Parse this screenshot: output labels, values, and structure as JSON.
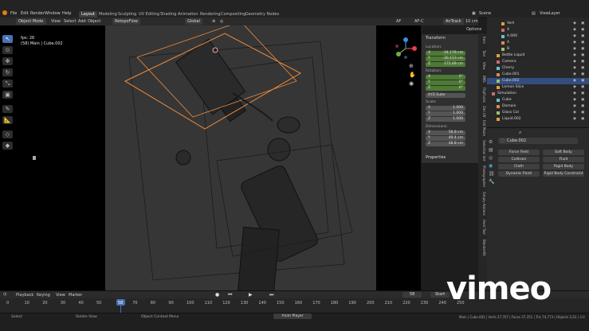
{
  "menu": [
    "File",
    "Edit",
    "Render",
    "Window",
    "Help"
  ],
  "workspaces": [
    "Layout",
    "Modeling",
    "Sculpting",
    "UV Editing",
    "Shading",
    "Animation",
    "Rendering",
    "Compositing",
    "Geometry Nodes"
  ],
  "scene_label": "Scene",
  "viewlayer_label": "ViewLayer",
  "header": {
    "mode": "Object Mode",
    "view": "View",
    "select": "Select",
    "add": "Add",
    "object": "Object",
    "addon": "RetopoFlow",
    "orientation": "Global",
    "options": "Options",
    "af": "AF",
    "ak": "AnTrack",
    "zoom": "10 cm"
  },
  "viewport_overlay": {
    "fps": "fps: 26",
    "object_info": "(58) Main | Cube.002"
  },
  "npanel": {
    "section": "Transform",
    "location_label": "Location:",
    "location": [
      {
        "k": "X",
        "v": "-34.178 cm"
      },
      {
        "k": "Y",
        "v": "-30.113 cm"
      },
      {
        "k": "Z",
        "v": "172.69 cm"
      }
    ],
    "rotation_label": "Rotation:",
    "rotation": [
      {
        "k": "X",
        "v": "0°"
      },
      {
        "k": "Y",
        "v": "0°"
      },
      {
        "k": "Z",
        "v": "0°"
      }
    ],
    "rotation_mode": "XYZ Euler",
    "scale_label": "Scale:",
    "scale": [
      {
        "k": "X",
        "v": "1.000"
      },
      {
        "k": "Y",
        "v": "1.000"
      },
      {
        "k": "Z",
        "v": "1.000"
      }
    ],
    "dimensions_label": "Dimensions:",
    "dimensions": [
      {
        "k": "X",
        "v": "58.8 cm"
      },
      {
        "k": "Y",
        "v": "49.4 cm"
      },
      {
        "k": "Z",
        "v": "48.8 cm"
      }
    ],
    "properties": "Properties"
  },
  "side_tabs": [
    "Item",
    "Tool",
    "View",
    "BMS",
    "FlipFluids",
    "Zen UV",
    "Edit Mode",
    "Selection Set",
    "Photographer",
    "Simply Addons",
    "Hard Tool",
    "BlenderKit"
  ],
  "outliner": [
    {
      "name": "Vert",
      "indent": 2,
      "sel": false
    },
    {
      "name": "X",
      "indent": 2,
      "sel": false
    },
    {
      "name": "A.000",
      "indent": 2,
      "sel": false
    },
    {
      "name": "A",
      "indent": 2,
      "sel": false
    },
    {
      "name": "B",
      "indent": 2,
      "sel": false
    },
    {
      "name": "Bottle Liquid",
      "indent": 1,
      "sel": false
    },
    {
      "name": "Camera",
      "indent": 1,
      "sel": false
    },
    {
      "name": "Cherry",
      "indent": 1,
      "sel": false
    },
    {
      "name": "Cube.001",
      "indent": 1,
      "sel": false
    },
    {
      "name": "Cube.002",
      "indent": 1,
      "sel": true
    },
    {
      "name": "Lemon Slice",
      "indent": 1,
      "sel": false
    },
    {
      "name": "Simulation",
      "indent": 0,
      "sel": false
    },
    {
      "name": "Cube",
      "indent": 1,
      "sel": false
    },
    {
      "name": "Domain",
      "indent": 1,
      "sel": false
    },
    {
      "name": "Glass Col",
      "indent": 1,
      "sel": false
    },
    {
      "name": "Liquid.002",
      "indent": 1,
      "sel": false
    }
  ],
  "props": {
    "object_name": "Cube.002",
    "buttons": [
      [
        "Force Field",
        "Soft Body"
      ],
      [
        "Collision",
        "Fluid"
      ],
      [
        "Cloth",
        "Rigid Body"
      ],
      [
        "Dynamic Paint",
        "Rigid Body Constraint"
      ]
    ]
  },
  "timeline": {
    "menus": [
      "Playback",
      "Keying",
      "View",
      "Marker"
    ],
    "current_frame": "58",
    "start_label": "Start",
    "ticks": [
      "0",
      "10",
      "20",
      "30",
      "40",
      "50",
      "58",
      "70",
      "80",
      "90",
      "100",
      "110",
      "120",
      "130",
      "140",
      "150",
      "160",
      "170",
      "180",
      "190",
      "200",
      "210",
      "220",
      "230",
      "240",
      "250"
    ]
  },
  "status": {
    "select": "Select",
    "rotate": "Rotate View",
    "context": "Object Context Menu",
    "anim": "Anim Player",
    "stats": "Main | Cube.002 | Verts 27,707 | Faces 37,351 | Tris 74,773 | Objects 1/23 | 3.0"
  },
  "watermark": "vimeo",
  "colors": {
    "selection": "#f08a3a",
    "accent": "#4772b3",
    "green": "#4d7a33"
  }
}
